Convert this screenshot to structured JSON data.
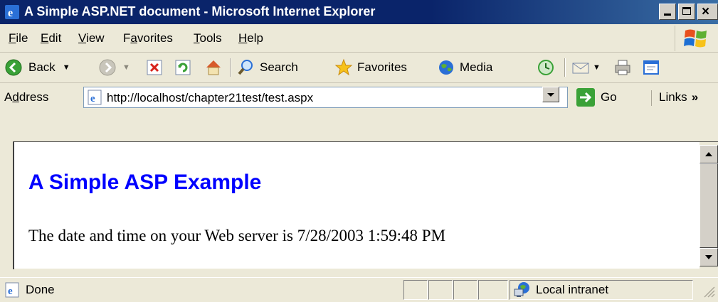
{
  "window": {
    "title": "A Simple ASP.NET document - Microsoft Internet Explorer"
  },
  "menu": {
    "items": [
      {
        "accel": "F",
        "rest": "ile"
      },
      {
        "accel": "E",
        "rest": "dit"
      },
      {
        "accel": "V",
        "rest": "iew"
      },
      {
        "pre": "F",
        "accel": "a",
        "rest": "vorites"
      },
      {
        "accel": "T",
        "rest": "ools"
      },
      {
        "accel": "H",
        "rest": "elp"
      }
    ]
  },
  "toolbar": {
    "back_label": "Back",
    "search_label": "Search",
    "favorites_label": "Favorites",
    "media_label": "Media"
  },
  "address": {
    "label_pre": "A",
    "label_accel": "d",
    "label_rest": "dress",
    "url": "http://localhost/chapter21test/test.aspx",
    "go_label": "Go",
    "links_label": "Links",
    "links_chevron": "»"
  },
  "page": {
    "heading": "A Simple ASP Example",
    "text": "The date and time on your Web server is 7/28/2003 1:59:48 PM"
  },
  "status": {
    "text": "Done",
    "zone": "Local intranet"
  },
  "colors": {
    "titlebar": "#0a246a",
    "heading": "#0000ff",
    "chrome": "#ece9d8"
  }
}
